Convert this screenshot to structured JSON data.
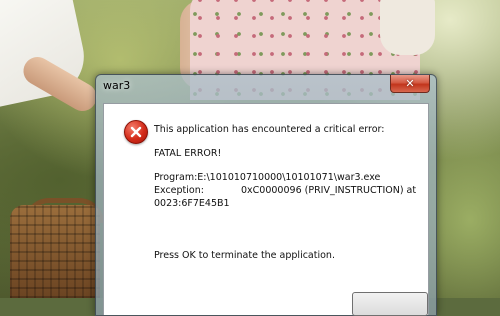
{
  "window": {
    "title": "war3",
    "close_glyph": "✕"
  },
  "dialog": {
    "header": "This application has encountered a critical error:",
    "fatal": "FATAL ERROR!",
    "program": "Program:E:\\101010710000\\10101071\\war3.exe",
    "exception_label": "Exception:",
    "exception_value": "0xC0000096 (PRIV_INSTRUCTION) at",
    "exception_address": "0023:6F7E45B1",
    "footer": "Press OK to terminate the application."
  },
  "icons": {
    "error": "error-icon",
    "close": "close-icon"
  },
  "colors": {
    "error_red": "#d32b19",
    "close_red": "#c2351c"
  }
}
